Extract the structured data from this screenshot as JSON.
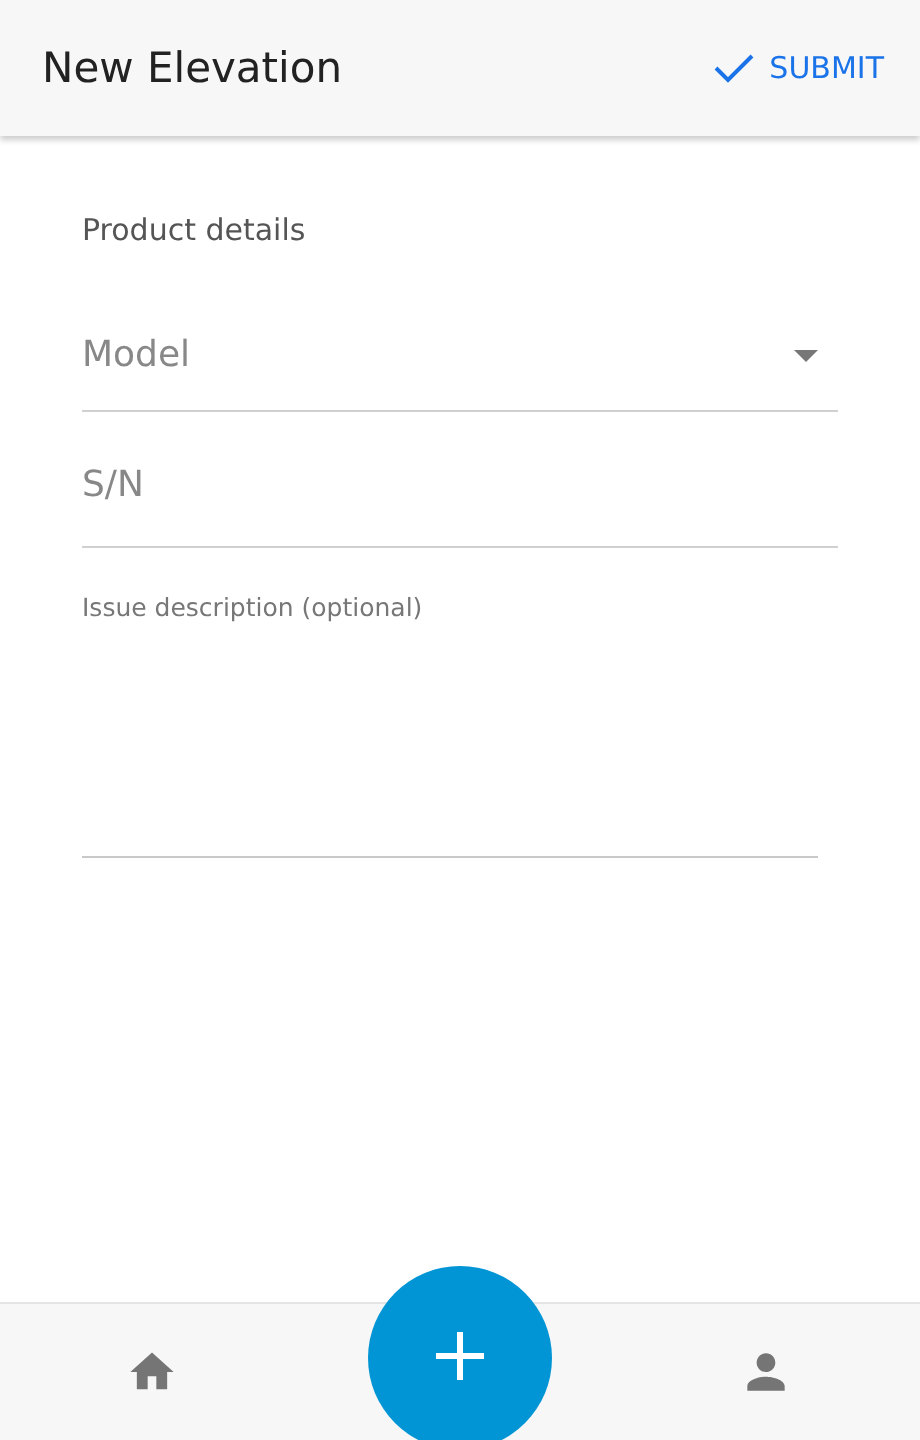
{
  "app_bar": {
    "title": "New Elevation",
    "action": "SUBMIT"
  },
  "section": {
    "title": "Product details"
  },
  "fields": [
    {
      "kind": "select",
      "placeholder": "Model"
    },
    {
      "kind": "text",
      "placeholder": "S/N"
    },
    {
      "kind": "textarea",
      "placeholder": "Issue description (optional)"
    }
  ]
}
